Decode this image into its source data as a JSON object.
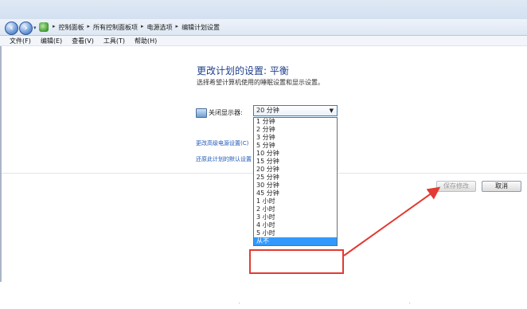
{
  "address": {
    "crumbs": [
      "控制面板",
      "所有控制面板项",
      "电源选项",
      "编辑计划设置"
    ]
  },
  "menu": [
    "文件(F)",
    "编辑(E)",
    "查看(V)",
    "工具(T)",
    "帮助(H)"
  ],
  "page": {
    "title": "更改计划的设置: 平衡",
    "subtitle": "选择希望计算机使用的睡眠设置和显示设置。"
  },
  "display_off": {
    "label": "关闭显示器:",
    "selected": "20 分钟",
    "options": [
      "1 分钟",
      "2 分钟",
      "3 分钟",
      "5 分钟",
      "10 分钟",
      "15 分钟",
      "20 分钟",
      "25 分钟",
      "30 分钟",
      "45 分钟",
      "1 小时",
      "2 小时",
      "3 小时",
      "4 小时",
      "5 小时",
      "从不"
    ],
    "highlighted": "从不"
  },
  "links": {
    "advanced": "更改高级电源设置(C)",
    "restore": "还原此计划的默认设置(R)"
  },
  "buttons": {
    "save": "保存修改",
    "cancel": "取消"
  },
  "colors": {
    "accent": "#3399ff",
    "annotation": "#e33a33",
    "title": "#1e3f8a"
  }
}
